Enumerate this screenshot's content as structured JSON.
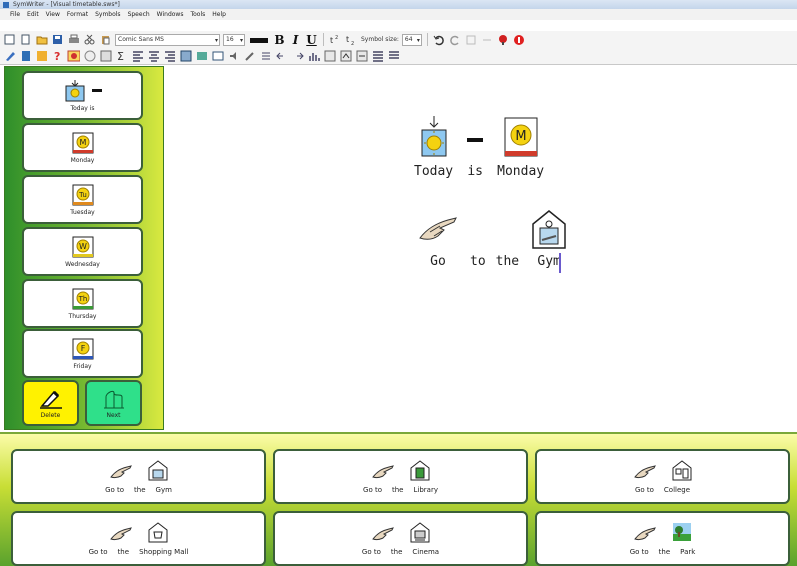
{
  "window": {
    "title": "SymWriter - [Visual timetable.sws*]"
  },
  "menu": [
    "File",
    "Edit",
    "View",
    "Format",
    "Symbols",
    "Speech",
    "Windows",
    "Tools",
    "Help"
  ],
  "toolbar": {
    "font_name": "Comic Sans MS",
    "font_size": "16",
    "bold": "B",
    "italic": "I",
    "underline": "U",
    "symbol_size_label": "Symbol size:",
    "symbol_size_value": "64"
  },
  "sidebar": {
    "days": [
      {
        "caption": "Today is",
        "symbol": "sun-arrow-icon"
      },
      {
        "caption": "Monday",
        "letter": "M",
        "bar": "#d03b2b"
      },
      {
        "caption": "Tuesday",
        "letter": "Tu",
        "bar": "#e08a1e"
      },
      {
        "caption": "Wednesday",
        "letter": "W",
        "bar": "#e2c81e"
      },
      {
        "caption": "Thursday",
        "letter": "Th",
        "bar": "#3a9a36"
      },
      {
        "caption": "Friday",
        "letter": "F",
        "bar": "#2d57b8"
      }
    ],
    "delete_label": "Delete",
    "next_label": "Next"
  },
  "document": {
    "line1": [
      "Today",
      "is",
      "Monday"
    ],
    "line2": [
      "Go",
      "to",
      "the",
      "Gym"
    ]
  },
  "destinations": [
    {
      "words": [
        "Go to",
        "the",
        "Gym"
      ],
      "place": "gym-icon"
    },
    {
      "words": [
        "Go to",
        "the",
        "Library"
      ],
      "place": "library-icon"
    },
    {
      "words": [
        "Go to",
        "College"
      ],
      "place": "college-icon"
    },
    {
      "words": [
        "Go to",
        "the",
        "Shopping Mall"
      ],
      "place": "shopping-mall-icon"
    },
    {
      "words": [
        "Go to",
        "the",
        "Cinema"
      ],
      "place": "cinema-icon"
    },
    {
      "words": [
        "Go to",
        "the",
        "Park"
      ],
      "place": "park-icon"
    }
  ],
  "colors": {
    "delete_button": "#fff200",
    "next_button": "#2fe08a",
    "caret": "#6a5acd"
  }
}
